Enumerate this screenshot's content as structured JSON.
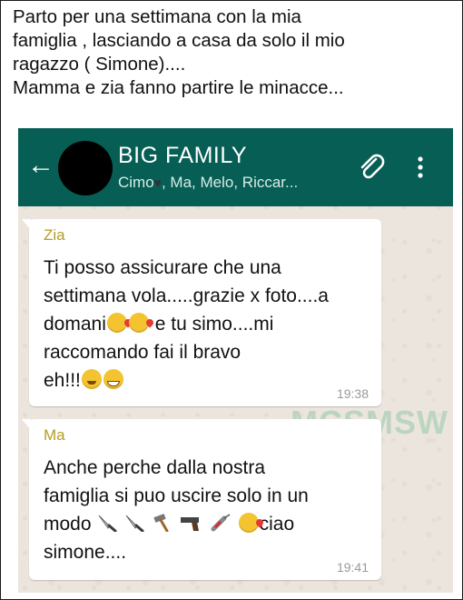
{
  "caption": {
    "text": "Parto per una settimana con la mia\nfamiglia , lasciando a casa da solo il mio\nragazzo ( Simone)....\nMamma e zia fanno partire le minacce..."
  },
  "chat": {
    "title": "BIG FAMILY",
    "subtitle_before": "Cimo",
    "subtitle_after": ", Ma, Melo, Riccar...",
    "header_color": "#075e54"
  },
  "messages": [
    {
      "sender": "Zia",
      "line1": "Ti posso assicurare che una",
      "line2": "settimana vola.....grazie x foto....a",
      "line3_a": "domani",
      "line3_b": " e tu simo....mi",
      "line4": "raccomando fai il bravo",
      "line5": "eh!!!",
      "time": "19:38"
    },
    {
      "sender": "Ma",
      "line1": "Anche perche dalla nostra",
      "line2": "famiglia si puo uscire solo in un",
      "line3_a": "modo",
      "line3_b": "ciao",
      "line4": "simone....",
      "time": "19:41"
    }
  ],
  "watermark": "MCSMSW",
  "icons": {
    "back": "arrow-left",
    "attach": "paperclip",
    "menu": "more-vertical",
    "heart": "black-heart",
    "emojis_msg1": [
      "kissing-face-heart",
      "kissing-face-heart",
      "winking-face",
      "grinning-face"
    ],
    "tools_msg2": [
      "kitchen-knife",
      "kitchen-knife",
      "hammer",
      "pistol",
      "syringe",
      "kissing-face-heart"
    ]
  }
}
